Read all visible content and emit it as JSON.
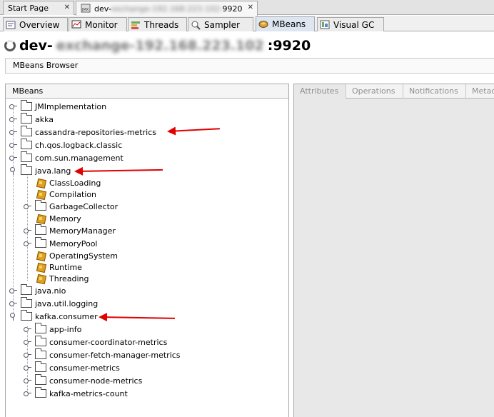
{
  "doc_tabs": [
    {
      "label": "Start Page",
      "close": "✕"
    },
    {
      "label_visible": "dev-",
      "label_blurred": "exchange-192.168.223.102:",
      "label_tail": "9920",
      "close": "✕"
    }
  ],
  "view_tabs": [
    {
      "label": "Overview",
      "icon": "overview-icon"
    },
    {
      "label": "Monitor",
      "icon": "monitor-icon"
    },
    {
      "label": "Threads",
      "icon": "threads-icon"
    },
    {
      "label": "Sampler",
      "icon": "sampler-icon"
    },
    {
      "label": "MBeans",
      "icon": "mbeans-icon",
      "active": true
    },
    {
      "label": "Visual GC",
      "icon": "visual-gc-icon"
    }
  ],
  "header": {
    "title_prefix": "dev-",
    "title_blurred": "exchange-192.168.223.102",
    "title_suffix": ":9920"
  },
  "browser_label": "MBeans Browser",
  "left_pane": {
    "header": "MBeans",
    "tree": [
      {
        "label": "JMImplementation",
        "type": "folder"
      },
      {
        "label": "akka",
        "type": "folder"
      },
      {
        "label": "cassandra-repositories-metrics",
        "type": "folder"
      },
      {
        "label": "ch.qos.logback.classic",
        "type": "folder"
      },
      {
        "label": "com.sun.management",
        "type": "folder"
      },
      {
        "label": "java.lang",
        "type": "folder",
        "expanded": true
      },
      {
        "label": "ClassLoading",
        "type": "bean"
      },
      {
        "label": "Compilation",
        "type": "bean"
      },
      {
        "label": "GarbageCollector",
        "type": "folder"
      },
      {
        "label": "Memory",
        "type": "bean"
      },
      {
        "label": "MemoryManager",
        "type": "folder"
      },
      {
        "label": "MemoryPool",
        "type": "folder"
      },
      {
        "label": "OperatingSystem",
        "type": "bean"
      },
      {
        "label": "Runtime",
        "type": "bean"
      },
      {
        "label": "Threading",
        "type": "bean"
      },
      {
        "label": "java.nio",
        "type": "folder"
      },
      {
        "label": "java.util.logging",
        "type": "folder"
      },
      {
        "label": "kafka.consumer",
        "type": "folder",
        "expanded": true
      },
      {
        "label": "app-info",
        "type": "folder"
      },
      {
        "label": "consumer-coordinator-metrics",
        "type": "folder"
      },
      {
        "label": "consumer-fetch-manager-metrics",
        "type": "folder"
      },
      {
        "label": "consumer-metrics",
        "type": "folder"
      },
      {
        "label": "consumer-node-metrics",
        "type": "folder"
      },
      {
        "label": "kafka-metrics-count",
        "type": "folder"
      }
    ]
  },
  "right_pane": {
    "tabs": [
      "Attributes",
      "Operations",
      "Notifications",
      "Metad"
    ]
  },
  "annotation_color": "#e00000"
}
